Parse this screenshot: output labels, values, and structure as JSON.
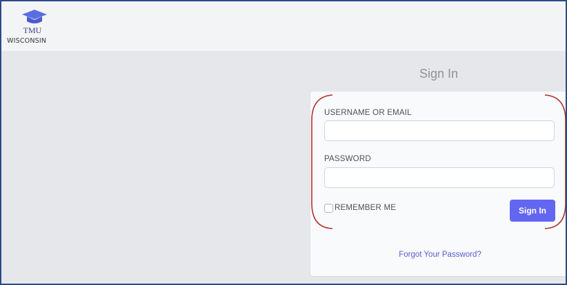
{
  "header": {
    "logo": {
      "icon": "graduation-cap-icon",
      "line1": "TMU",
      "line2": "WISCONSIN",
      "color": "#5b6ee1"
    }
  },
  "signin": {
    "heading": "Sign In",
    "username": {
      "label": "USERNAME OR EMAIL",
      "value": "",
      "placeholder": ""
    },
    "password": {
      "label": "PASSWORD",
      "value": "",
      "placeholder": ""
    },
    "remember_label": "REMEMBER ME",
    "remember_checked": false,
    "submit_label": "Sign In",
    "forgot_label": "Forgot Your Password?"
  },
  "colors": {
    "accent": "#6366f1",
    "link": "#5b5bd6",
    "annotation": "#b03030",
    "frame": "#2a4a8a"
  }
}
